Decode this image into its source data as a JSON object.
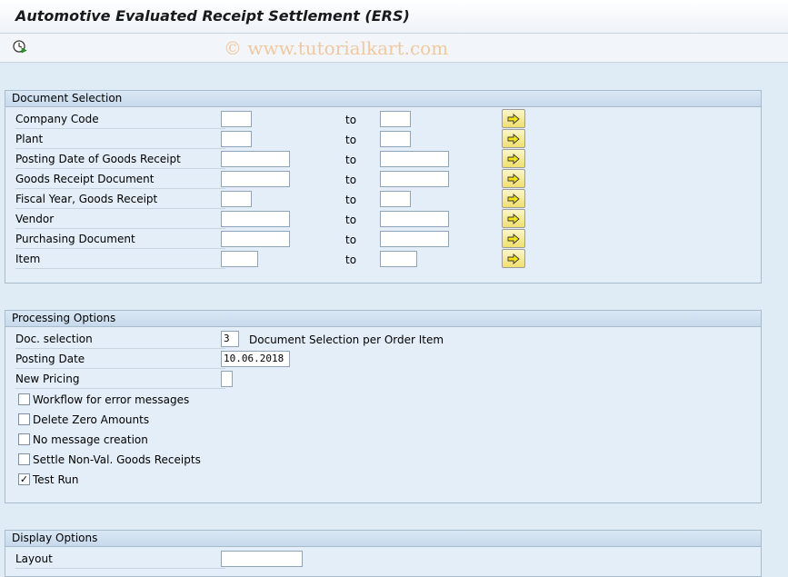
{
  "window": {
    "title": "Automotive Evaluated Receipt Settlement (ERS)"
  },
  "toolbar": {
    "execute_icon": "execute-clock-icon",
    "watermark": "© www.tutorialkart.com"
  },
  "document_selection": {
    "header": "Document Selection",
    "to_label": "to",
    "rows": [
      {
        "label": "Company Code",
        "from": "",
        "to": ""
      },
      {
        "label": "Plant",
        "from": "",
        "to": ""
      },
      {
        "label": "Posting Date of Goods Receipt",
        "from": "",
        "to": ""
      },
      {
        "label": "Goods Receipt Document",
        "from": "",
        "to": ""
      },
      {
        "label": "Fiscal Year, Goods Receipt",
        "from": "",
        "to": ""
      },
      {
        "label": "Vendor",
        "from": "",
        "to": ""
      },
      {
        "label": "Purchasing Document",
        "from": "",
        "to": ""
      },
      {
        "label": "Item",
        "from": "",
        "to": ""
      }
    ]
  },
  "processing_options": {
    "header": "Processing Options",
    "doc_selection": {
      "label": "Doc. selection",
      "value": "3",
      "description": "Document Selection per Order Item"
    },
    "posting_date": {
      "label": "Posting Date",
      "value": "10.06.2018"
    },
    "new_pricing": {
      "label": "New Pricing",
      "value": ""
    },
    "checkboxes": [
      {
        "label": "Workflow for error messages",
        "checked": false
      },
      {
        "label": "Delete Zero Amounts",
        "checked": false
      },
      {
        "label": "No message creation",
        "checked": false
      },
      {
        "label": "Settle Non-Val. Goods Receipts",
        "checked": false
      },
      {
        "label": "Test Run",
        "checked": true
      }
    ]
  },
  "display_options": {
    "header": "Display Options",
    "layout": {
      "label": "Layout",
      "value": ""
    }
  }
}
